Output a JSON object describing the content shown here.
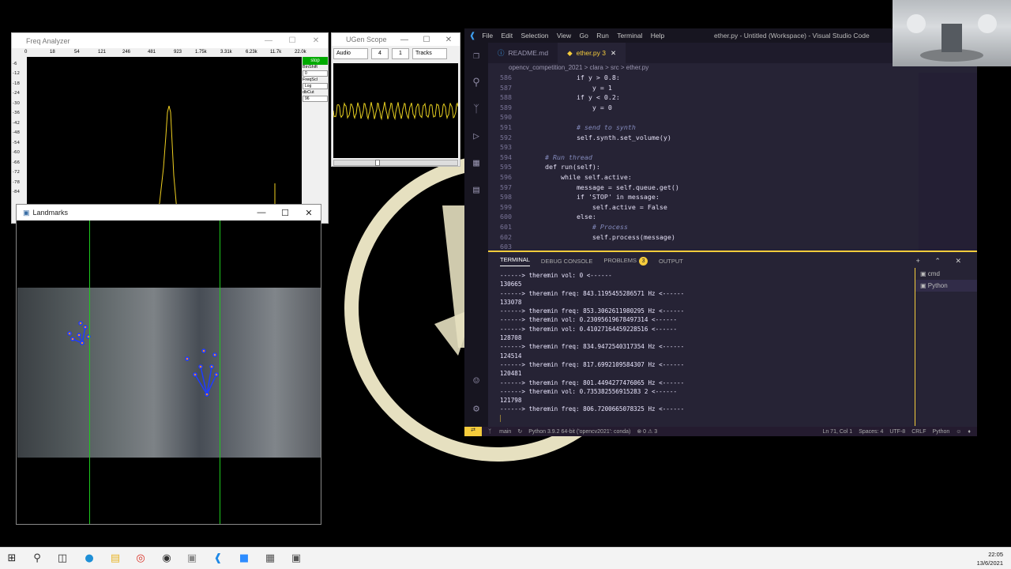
{
  "freq_analyzer": {
    "title": "Freq Analyzer",
    "scale_labels": [
      "0",
      "18",
      "54",
      "121",
      "246",
      "481",
      "923",
      "1.75k",
      "3.31k",
      "6.23k",
      "11.7k",
      "22.0k"
    ],
    "y_labels": [
      "-6",
      "-12",
      "-18",
      "-24",
      "-30",
      "-36",
      "-42",
      "-48",
      "-54",
      "-60",
      "-66",
      "-72",
      "-78",
      "-84"
    ],
    "stop_label": "stop",
    "ctrl_labels": [
      "BinShift",
      "0",
      "FreqScl",
      "Log",
      "dbCut",
      "96"
    ]
  },
  "scope": {
    "title": "UGen Scope",
    "bus_type": "Audio",
    "num_channels": "4",
    "index": "1",
    "style": "Tracks"
  },
  "landmarks": {
    "title": "Landmarks"
  },
  "vscode": {
    "menu": [
      "File",
      "Edit",
      "Selection",
      "View",
      "Go",
      "Run",
      "Terminal",
      "Help"
    ],
    "window_title": "ether.py - Untitled (Workspace) - Visual Studio Code",
    "tabs": [
      {
        "label": "README.md"
      },
      {
        "label": "ether.py 3"
      }
    ],
    "breadcrumbs": "opencv_competition_2021 > clara > src > ether.py",
    "code_lines": [
      {
        "n": "586",
        "code": "            if y > 0.8:"
      },
      {
        "n": "587",
        "code": "                y = 1"
      },
      {
        "n": "588",
        "code": "            if y < 0.2:"
      },
      {
        "n": "589",
        "code": "                y = 0"
      },
      {
        "n": "590",
        "code": ""
      },
      {
        "n": "591",
        "code": "            # send to synth"
      },
      {
        "n": "592",
        "code": "            self.synth.set_volume(y)"
      },
      {
        "n": "593",
        "code": ""
      },
      {
        "n": "594",
        "code": "    # Run thread"
      },
      {
        "n": "595",
        "code": "    def run(self):"
      },
      {
        "n": "596",
        "code": "        while self.active:"
      },
      {
        "n": "597",
        "code": "            message = self.queue.get()"
      },
      {
        "n": "598",
        "code": "            if 'STOP' in message:"
      },
      {
        "n": "599",
        "code": "                self.active = False"
      },
      {
        "n": "600",
        "code": "            else:"
      },
      {
        "n": "601",
        "code": "                # Process"
      },
      {
        "n": "602",
        "code": "                self.process(message)"
      },
      {
        "n": "603",
        "code": ""
      }
    ],
    "panel_tabs": {
      "terminal": "TERMINAL",
      "debug": "DEBUG CONSOLE",
      "problems": "PROBLEMS",
      "problems_count": "3",
      "output": "OUTPUT"
    },
    "terminal_lines": [
      "------> theremin vol: 0 <------",
      "130665",
      "------> theremin freq: 843.1195455286571 Hz <------",
      "133078",
      "------> theremin freq: 853.3062611980295 Hz <------",
      "------> theremin vol: 0.23095619678497314 <------",
      "------> theremin vol: 0.41027164459228516 <------",
      "128708",
      "------> theremin freq: 834.9472540317354 Hz <------",
      "124514",
      "------> theremin freq: 817.6992109584307 Hz <------",
      "120481",
      "------> theremin freq: 801.4494277476065 Hz <------",
      "------> theremin vol: 0.735382556915283 2 <------",
      "121798",
      "------> theremin freq: 806.7200665078325 Hz <------"
    ],
    "terminal_instances": [
      "cmd",
      "Python"
    ],
    "status": {
      "branch": "main",
      "interpreter": "Python 3.9.2 64-bit ('opencv2021': conda)",
      "problems": "⊗ 0 ⚠ 3",
      "position": "Ln 71, Col 1",
      "spaces": "Spaces: 4",
      "encoding": "UTF-8",
      "eol": "CRLF",
      "language": "Python"
    }
  },
  "taskbar": {
    "time": "22:05",
    "date": "13/6/2021"
  }
}
